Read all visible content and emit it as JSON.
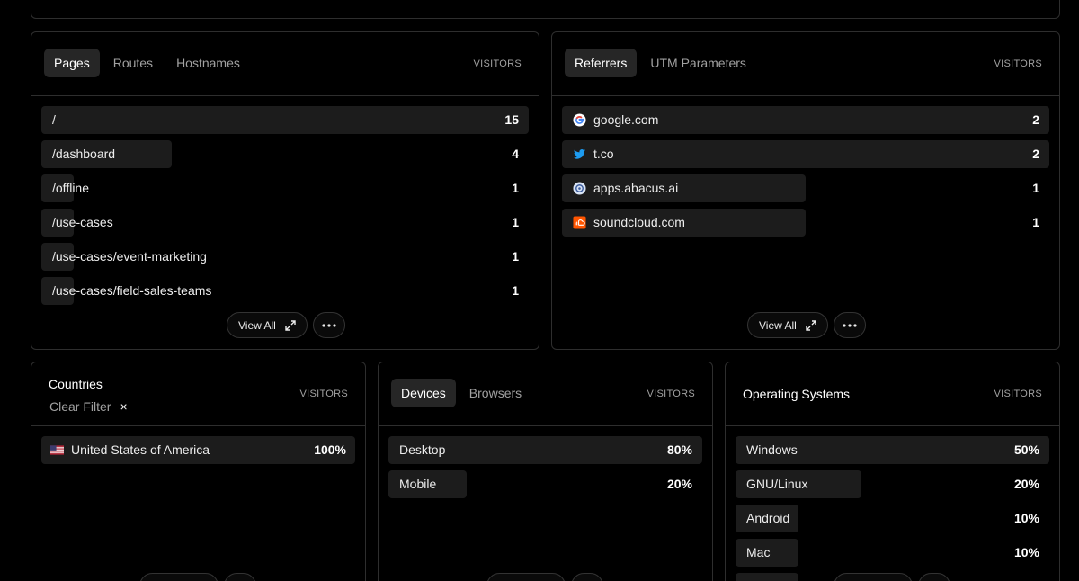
{
  "pages_card": {
    "tabs": [
      "Pages",
      "Routes",
      "Hostnames"
    ],
    "column": "VISITORS",
    "rows": [
      {
        "label": "/",
        "value": "15",
        "share": 1.0
      },
      {
        "label": "/dashboard",
        "value": "4",
        "share": 0.267
      },
      {
        "label": "/offline",
        "value": "1",
        "share": 0.067
      },
      {
        "label": "/use-cases",
        "value": "1",
        "share": 0.067
      },
      {
        "label": "/use-cases/event-marketing",
        "value": "1",
        "share": 0.067
      },
      {
        "label": "/use-cases/field-sales-teams",
        "value": "1",
        "share": 0.067
      }
    ],
    "view_all": "View All"
  },
  "referrers_card": {
    "tabs": [
      "Referrers",
      "UTM Parameters"
    ],
    "column": "VISITORS",
    "rows": [
      {
        "label": "google.com",
        "value": "2",
        "share": 1.0,
        "icon": "google-icon"
      },
      {
        "label": "t.co",
        "value": "2",
        "share": 1.0,
        "icon": "twitter-icon"
      },
      {
        "label": "apps.abacus.ai",
        "value": "1",
        "share": 0.5,
        "icon": "abacus-icon"
      },
      {
        "label": "soundcloud.com",
        "value": "1",
        "share": 0.5,
        "icon": "soundcloud-icon"
      }
    ],
    "view_all": "View All"
  },
  "countries_card": {
    "title": "Countries",
    "clear_filter": "Clear Filter",
    "clear_icon": "×",
    "column": "VISITORS",
    "rows": [
      {
        "label": "United States of America",
        "value": "100%",
        "share": 1.0,
        "icon": "us-flag-icon"
      }
    ]
  },
  "devices_card": {
    "tabs": [
      "Devices",
      "Browsers"
    ],
    "column": "VISITORS",
    "rows": [
      {
        "label": "Desktop",
        "value": "80%",
        "share": 1.0
      },
      {
        "label": "Mobile",
        "value": "20%",
        "share": 0.25
      }
    ]
  },
  "os_card": {
    "title": "Operating Systems",
    "column": "VISITORS",
    "rows": [
      {
        "label": "Windows",
        "value": "50%",
        "share": 1.0
      },
      {
        "label": "GNU/Linux",
        "value": "20%",
        "share": 0.4
      },
      {
        "label": "Android",
        "value": "10%",
        "share": 0.2
      },
      {
        "label": "Mac",
        "value": "10%",
        "share": 0.2
      }
    ]
  },
  "colors": {
    "background": "#000000",
    "card_border": "#2e2e2e",
    "bar": "#1c1c1c",
    "active_tab": "#262626"
  }
}
